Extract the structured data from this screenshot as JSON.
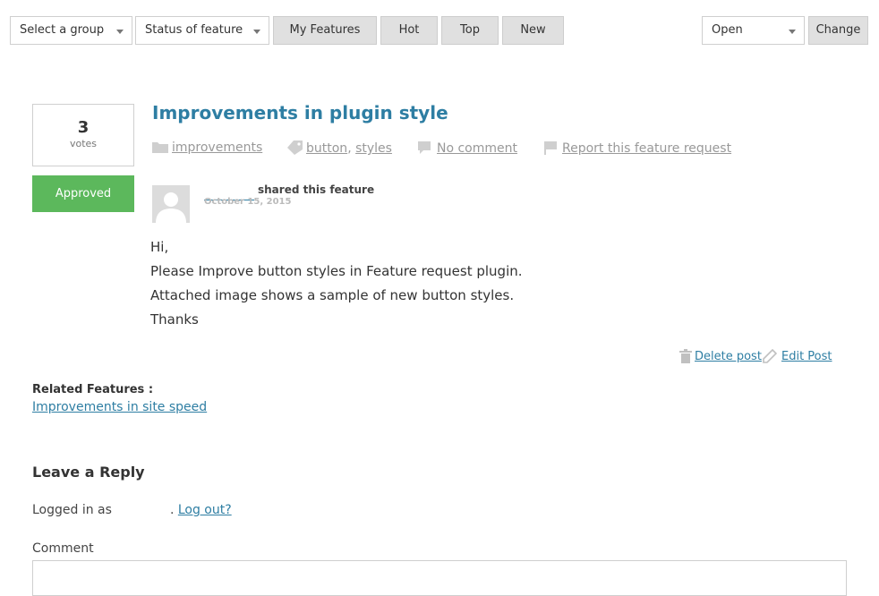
{
  "toolbar": {
    "group_select": "Select a group",
    "status_select": "Status of feature",
    "my_features": "My Features",
    "hot": "Hot",
    "top": "Top",
    "new": "New",
    "open_select": "Open",
    "change": "Change"
  },
  "feature": {
    "votes_count": "3",
    "votes_label": "votes",
    "status": "Approved",
    "title": "Improvements in plugin style",
    "category": "improvements",
    "tags": [
      "button",
      "styles"
    ],
    "comments": "No comment",
    "report": "Report this feature request",
    "shared_text": "shared this feature",
    "date": "October 15, 2015",
    "body": [
      "Hi,",
      "Please Improve button styles in Feature request plugin.",
      "Attached image shows a sample of new button styles.",
      "Thanks"
    ],
    "delete_post": "Delete post",
    "edit_post": "Edit Post"
  },
  "related": {
    "title": "Related Features :",
    "items": [
      "Improvements in site speed"
    ]
  },
  "reply": {
    "title": "Leave a Reply",
    "logged_in_as": "Logged in as",
    "logout": "Log out?",
    "comment_label": "Comment"
  },
  "colors": {
    "accent": "#2e7ea3",
    "approved": "#5cb85c",
    "button_bg": "#e0e0e0"
  },
  "icons": [
    "folder-icon",
    "tag-icon",
    "comment-icon",
    "flag-icon",
    "avatar-icon",
    "trash-icon",
    "pencil-icon",
    "chevron-down-icon"
  ]
}
